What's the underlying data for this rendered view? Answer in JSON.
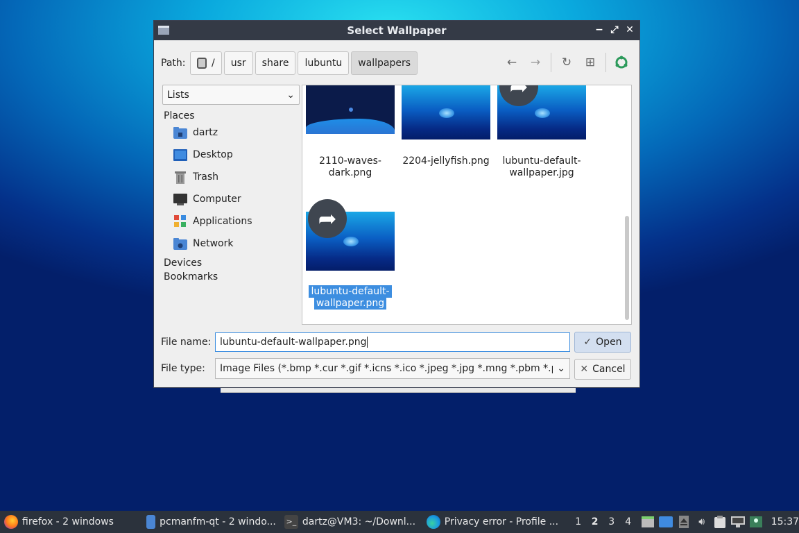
{
  "dialog": {
    "title": "Select Wallpaper",
    "window_buttons": {
      "minimize": "−",
      "maximize": "⤢",
      "close": "✕"
    }
  },
  "path": {
    "label": "Path:",
    "crumbs": [
      "/",
      "usr",
      "share",
      "lubuntu",
      "wallpapers"
    ]
  },
  "toolbar": {
    "back": "←",
    "forward": "→",
    "reload": "↻",
    "new_folder": "⊞"
  },
  "sidebar": {
    "view_mode": "Lists",
    "sections": {
      "places": "Places",
      "devices": "Devices",
      "bookmarks": "Bookmarks"
    },
    "places": [
      {
        "label": "dartz",
        "icon": "home-folder-icon"
      },
      {
        "label": "Desktop",
        "icon": "desktop-icon"
      },
      {
        "label": "Trash",
        "icon": "trash-icon"
      },
      {
        "label": "Computer",
        "icon": "computer-icon"
      },
      {
        "label": "Applications",
        "icon": "applications-icon"
      },
      {
        "label": "Network",
        "icon": "network-folder-icon"
      }
    ]
  },
  "files": [
    {
      "name_line1": "2110-waves-",
      "name_line2": "dark.png",
      "selected": false
    },
    {
      "name_line1": "2204-jellyfish.png",
      "name_line2": "",
      "selected": false
    },
    {
      "name_line1": "lubuntu-default-",
      "name_line2": "wallpaper.jpg",
      "selected": false,
      "symlink": true
    },
    {
      "name_line1": "lubuntu-default-",
      "name_line2": "wallpaper.png",
      "selected": true,
      "symlink": true
    }
  ],
  "filename": {
    "label": "File name:",
    "value": "lubuntu-default-wallpaper.png"
  },
  "filetype": {
    "label": "File type:",
    "value": "Image Files (*.bmp *.cur *.gif *.icns *.ico *.jpeg *.jpg *.mng *.pbm *.pgm"
  },
  "buttons": {
    "open": "Open",
    "cancel": "Cancel"
  },
  "taskbar": {
    "tasks": [
      {
        "label": "firefox - 2 windows",
        "icon": "firefox-icon"
      },
      {
        "label": "pcmanfm-qt - 2 windo...",
        "icon": "folder-icon"
      },
      {
        "label": "dartz@VM3: ~/Downl...",
        "icon": "terminal-icon"
      },
      {
        "label": "Privacy error - Profile ...",
        "icon": "edge-icon"
      }
    ],
    "desktops": [
      "1",
      "2",
      "3",
      "4"
    ],
    "active_desktop": "2",
    "clock": "15:37"
  },
  "colors": {
    "accent": "#3d8ee0",
    "titlebar": "#343a46",
    "taskbar": "#2b323c"
  }
}
